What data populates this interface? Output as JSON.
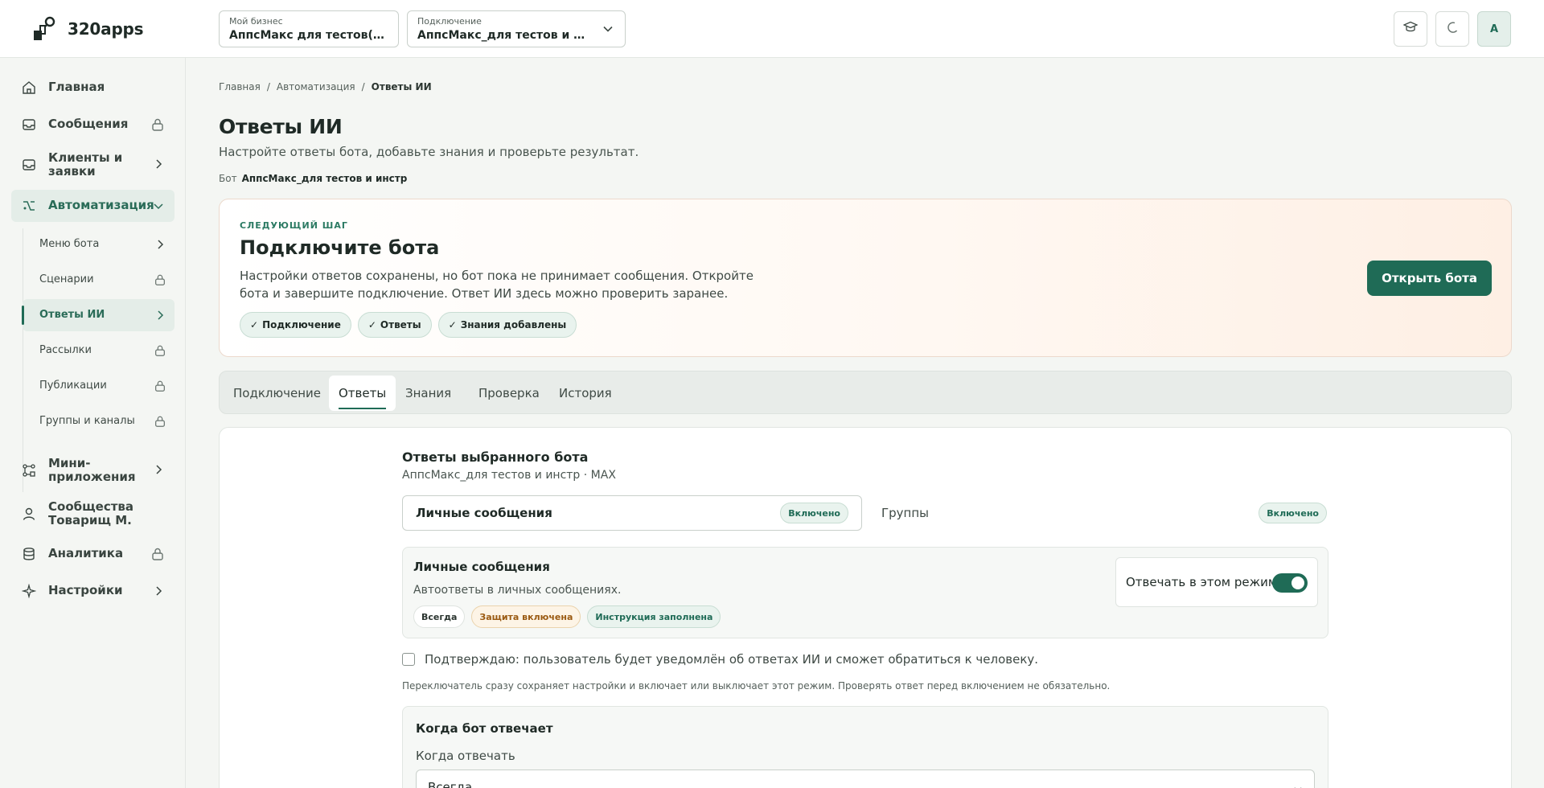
{
  "app": {
    "name": "320apps"
  },
  "header": {
    "business": {
      "label": "Мой бизнес",
      "value": "АппсМакс для тестов(инст…"
    },
    "connection": {
      "label": "Подключение",
      "value": "АппсМакс_для тестов и инстр"
    },
    "avatar_letter": "А"
  },
  "sidebar": {
    "items": [
      {
        "label": "Главная",
        "icon": "home-icon"
      },
      {
        "label": "Сообщения",
        "icon": "inbox-icon",
        "locked": true
      },
      {
        "label": "Клиенты и заявки",
        "icon": "inbox-icon"
      },
      {
        "label": "Автоматизация",
        "icon": "automation-icon",
        "active": true
      },
      {
        "label": "Мини-приложения",
        "icon": "apps-icon"
      },
      {
        "label": "Сообщества Товарищ М.",
        "icon": "user-icon"
      },
      {
        "label": "Аналитика",
        "icon": "database-icon",
        "locked": true
      },
      {
        "label": "Настройки",
        "icon": "sparkle-icon"
      }
    ],
    "subitems": [
      {
        "label": "Меню бота"
      },
      {
        "label": "Сценарии",
        "locked": true
      },
      {
        "label": "Ответы ИИ",
        "active": true
      },
      {
        "label": "Рассылки",
        "locked": true
      },
      {
        "label": "Публикации",
        "locked": true
      },
      {
        "label": "Группы и каналы",
        "locked": true
      }
    ]
  },
  "breadcrumb": [
    "Главная",
    "Автоматизация",
    "Ответы ИИ"
  ],
  "page": {
    "title": "Ответы ИИ",
    "subtitle": "Настройте ответы бота, добавьте знания и проверьте результат.",
    "bot_label": "Бот",
    "bot_name": "АппсМакс_для тестов и инстр"
  },
  "next_step": {
    "kicker": "СЛЕДУЮЩИЙ ШАГ",
    "title": "Подключите бота",
    "description": "Настройки ответов сохранены, но бот пока не принимает сообщения. Откройте бота и завершите подключение. Ответ ИИ здесь можно проверить заранее.",
    "chips": [
      "Подключение",
      "Ответы",
      "Знания добавлены"
    ],
    "button": "Открыть бота"
  },
  "tabs": [
    {
      "label": "Подключение"
    },
    {
      "label": "Ответы",
      "active": true
    },
    {
      "label": "Знания"
    },
    {
      "label": "Проверка"
    },
    {
      "label": "История"
    }
  ],
  "answers": {
    "title": "Ответы выбранного бота",
    "subtitle": "АппсМакс_для тестов и инстр · MAX",
    "modes": [
      {
        "name": "Личные сообщения",
        "status": "Включено"
      },
      {
        "name": "Группы",
        "status": "Включено"
      }
    ],
    "detail": {
      "title": "Личные сообщения",
      "description": "Автоответы в личных сообщениях.",
      "tags": [
        "Всегда",
        "Защита включена",
        "Инструкция заполнена"
      ],
      "toggle_label": "Отвечать в этом режиме",
      "toggle_on": true
    },
    "confirm_label": "Подтверждаю: пользователь будет уведомлён об ответах ИИ и сможет обратиться к человеку.",
    "hint": "Переключатель сразу сохраняет настройки и включает или выключает этот режим. Проверять ответ перед включением не обязательно.",
    "when": {
      "title": "Когда бот отвечает",
      "label": "Когда отвечать",
      "value": "Всегда"
    }
  },
  "colors": {
    "accent": "#1f6b56",
    "background": "#f4f6f3",
    "warn": "#9a5a12"
  }
}
